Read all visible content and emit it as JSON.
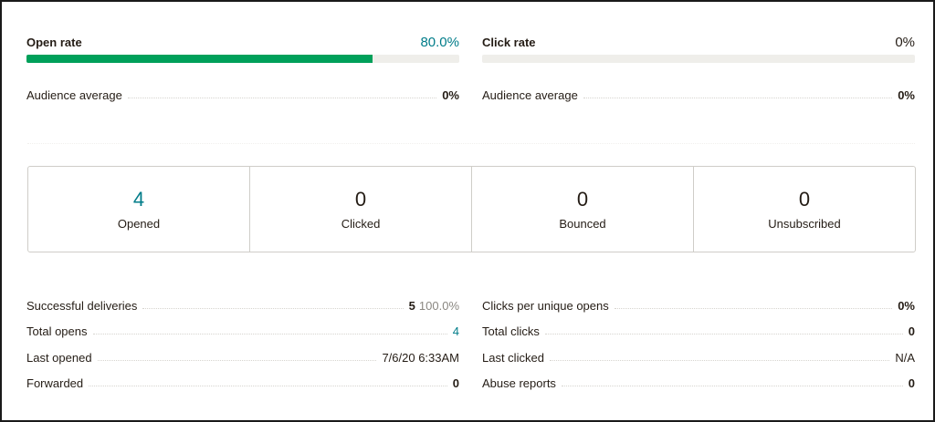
{
  "open_rate": {
    "label": "Open rate",
    "value": "80.0%",
    "fill": 0.8,
    "accent": "#007c89",
    "bar_color": "#00a05a"
  },
  "click_rate": {
    "label": "Click rate",
    "value": "0%",
    "fill": 0.0
  },
  "audience_left": {
    "label": "Audience average",
    "value": "0%"
  },
  "audience_right": {
    "label": "Audience average",
    "value": "0%"
  },
  "summary_boxes": [
    {
      "number": "4",
      "label": "Opened"
    },
    {
      "number": "0",
      "label": "Clicked"
    },
    {
      "number": "0",
      "label": "Bounced"
    },
    {
      "number": "0",
      "label": "Unsubscribed"
    }
  ],
  "left_stats": [
    {
      "label": "Successful deliveries",
      "value": "5",
      "sub": "100.0%"
    },
    {
      "label": "Total opens",
      "value": "4"
    },
    {
      "label": "Last opened",
      "value": "7/6/20 6:33AM"
    },
    {
      "label": "Forwarded",
      "value": "0"
    }
  ],
  "right_stats": [
    {
      "label": "Clicks per unique opens",
      "value": "0%"
    },
    {
      "label": "Total clicks",
      "value": "0"
    },
    {
      "label": "Last clicked",
      "value": "N/A"
    },
    {
      "label": "Abuse reports",
      "value": "0"
    }
  ]
}
